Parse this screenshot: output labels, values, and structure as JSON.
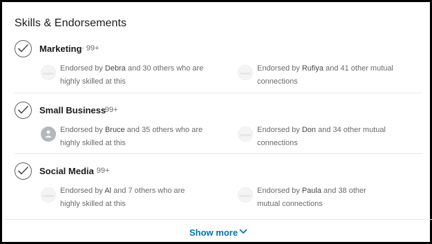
{
  "section": {
    "title": "Skills & Endorsements"
  },
  "skills": [
    {
      "name": "Marketing",
      "count": "· 99+",
      "left": {
        "prefix": "Endorsed by ",
        "name": "Debra",
        "blur": " ",
        "rest": " and 30 others who are",
        "line2": "highly skilled at this"
      },
      "right": {
        "prefix": "Endorsed by ",
        "name": "Rufiya",
        "blur": " ",
        "rest": " and 41 other mutual",
        "line2": "connections"
      }
    },
    {
      "name": "Small Business",
      "count": "· 99+",
      "left": {
        "prefix": "Endorsed by ",
        "name": "Bruce",
        "blur": " ",
        "rest": " and 35 others who are",
        "line2": "highly skilled at this"
      },
      "right": {
        "prefix": "Endorsed by ",
        "name": "Don",
        "blur": " ",
        "rest": " and 34 other mutual",
        "line2": "connections"
      }
    },
    {
      "name": "Social Media",
      "count": "· 99+",
      "left": {
        "prefix": "Endorsed by ",
        "name": "Al",
        "blur": " ",
        "rest": " and 7 others who are",
        "line2": "highly skilled at this"
      },
      "right": {
        "prefix": "Endorsed by ",
        "name": "Paula",
        "blur": " ",
        "rest": " and 38 other",
        "line2": "mutual connections"
      }
    }
  ],
  "footer": {
    "show_more": "Show more"
  },
  "colors": {
    "link": "#0073b1",
    "divider": "#e6e9ec",
    "frame": "#000000"
  },
  "icons": {
    "check": "checkmark-circle-icon",
    "chevron": "chevron-down-icon",
    "person": "person-silhouette-icon"
  }
}
